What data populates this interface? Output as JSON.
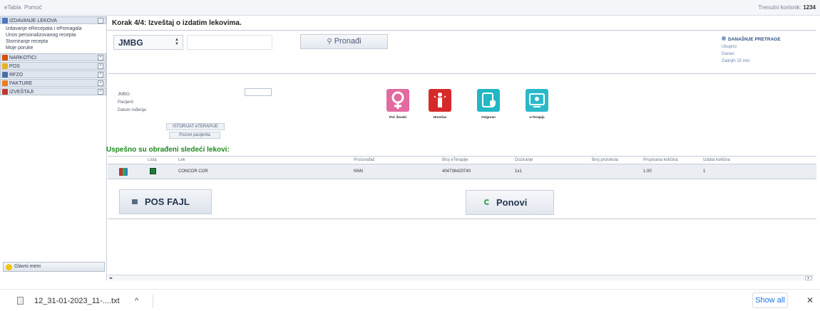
{
  "menubar": {
    "items": [
      "eTabla",
      "Pomoć"
    ],
    "user_label": "Trenutni korisnik:",
    "user_id": "1234"
  },
  "sidebar": {
    "sections": [
      {
        "label": "IZDAVANJE LEKOVA",
        "icon": "pharmacy-icon",
        "color": "#4a78c2",
        "toggle": "−"
      },
      {
        "label": "NARKOTICI",
        "icon": "leaf-icon",
        "color": "#d35400",
        "toggle": "+"
      },
      {
        "label": "POS",
        "icon": "pos-icon",
        "color": "#e6b422",
        "toggle": "+"
      },
      {
        "label": "RFZO",
        "icon": "rfzo-icon",
        "color": "#4a6fa5",
        "toggle": "+"
      },
      {
        "label": "FAKTURE",
        "icon": "invoice-icon",
        "color": "#e67e22",
        "toggle": "+"
      },
      {
        "label": "IZVEŠTAJI",
        "icon": "reports-icon",
        "color": "#c0392b",
        "toggle": "+"
      }
    ],
    "subitems": [
      "Izdavanje eRecepata i ePomagala",
      "Unos personalizovanog recepta",
      "Storniranje recepta",
      "Moje poruke"
    ],
    "main_menu": "Glavni meni"
  },
  "main": {
    "step_title": "Korak 4/4: Izveštaj o izdatim lekovima.",
    "search": {
      "type_value": "JMBG",
      "input_value": "",
      "button": "Pronađi"
    },
    "today": {
      "title": "DANAŠNJE PRETRAGE",
      "total": "Ukupno:",
      "today": "Danas:",
      "last15": "Zadnjih 15 min:"
    },
    "patient": {
      "jmbg_label": "JMBG:",
      "patient_label": "Pacijent:",
      "dob_label": "Datum rođenja:",
      "history_btn": "ISTORIJAT eTERAPIJE",
      "call_btn": "Pozovi pacijenta"
    },
    "tiles": [
      {
        "label": "Pol: Ženski",
        "icon": "female-icon",
        "color": "#e36aa0"
      },
      {
        "label": "Hroničar",
        "icon": "chronic-patient-icon",
        "color": "#d62a2a"
      },
      {
        "label": "Osiguran",
        "icon": "insured-icon",
        "color": "#22b7c4"
      },
      {
        "label": "e-Terapija",
        "icon": "e-therapy-icon",
        "color": "#2bb9c9"
      }
    ],
    "success_msg": "Uspešno su obrađeni sledeći lekovi:",
    "table": {
      "headers": [
        "Lista",
        "Lek",
        "Proizvođač",
        "Broj eTerapije",
        "Doziranje",
        "Broj protokola",
        "Propisana količina",
        "Izdata količina"
      ],
      "rows": [
        {
          "lista": "",
          "lek": "CONCOR COR",
          "proizvodjac": "NNN",
          "broj": "404736420740",
          "doziranje": "1x1",
          "protokol": "",
          "propisana": "1.00",
          "izdata": "1"
        }
      ]
    },
    "pos_btn": "POS FAJL",
    "ponovi_btn": "Ponovi"
  },
  "downloads": {
    "file": "12_31-01-2023_11-....txt",
    "show_all": "Show all"
  }
}
